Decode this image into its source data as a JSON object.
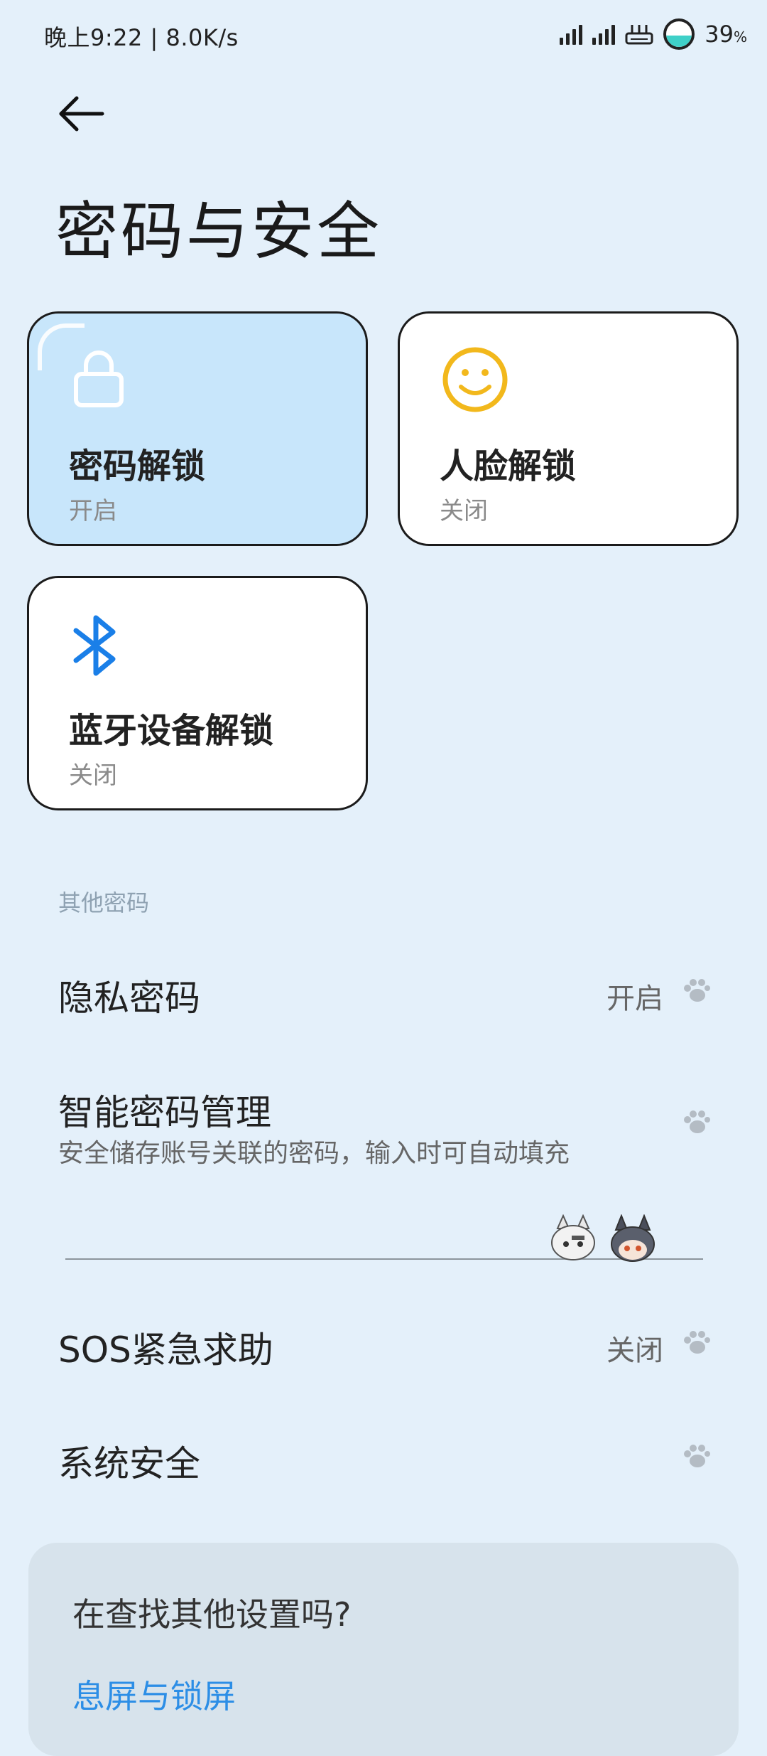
{
  "status_bar": {
    "time_speed": "晚上9:22 | 8.0K/s",
    "battery": "39",
    "battery_unit": "%"
  },
  "header": {
    "title": "密码与安全"
  },
  "unlock_cards": [
    {
      "label": "密码解锁",
      "status": "开启",
      "icon": "lock-icon"
    },
    {
      "label": "人脸解锁",
      "status": "关闭",
      "icon": "smiley-face-icon"
    },
    {
      "label": "蓝牙设备解锁",
      "status": "关闭",
      "icon": "bluetooth-icon"
    }
  ],
  "other_section": {
    "header": "其他密码",
    "items": [
      {
        "title": "隐私密码",
        "value": "开启"
      },
      {
        "title": "智能密码管理",
        "desc": "安全储存账号关联的密码，输入时可自动填充"
      },
      {
        "title": "SOS紧急求助",
        "value": "关闭"
      },
      {
        "title": "系统安全"
      }
    ]
  },
  "suggestion": {
    "question": "在查找其他设置吗?",
    "link": "息屏与锁屏"
  },
  "colors": {
    "background": "#e4f0fa",
    "active_card": "#c8e6fb",
    "face_icon": "#f2b81c",
    "bluetooth_icon": "#1a7fe8",
    "link": "#2c8ee6"
  }
}
